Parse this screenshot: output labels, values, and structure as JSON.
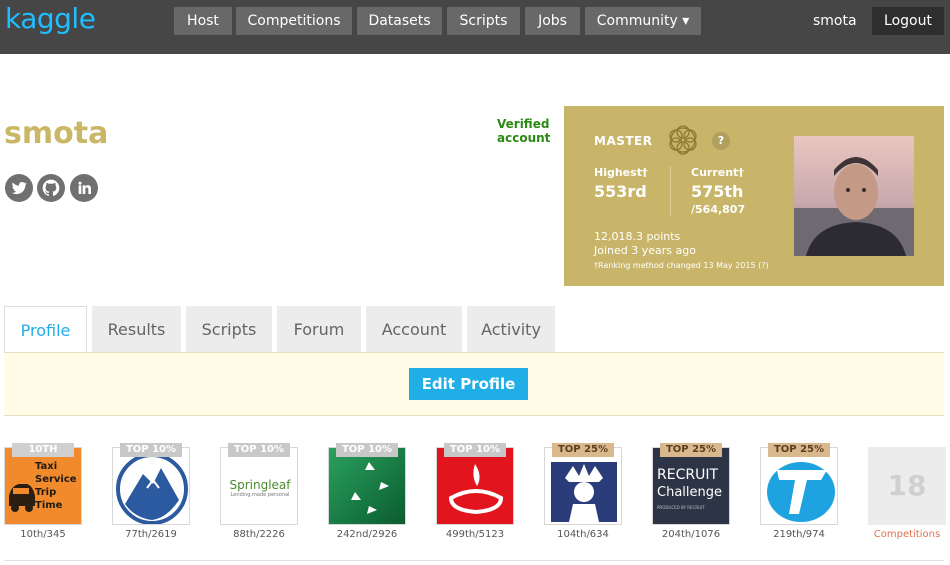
{
  "nav": {
    "logo": "kaggle",
    "items": [
      "Host",
      "Competitions",
      "Datasets",
      "Scripts",
      "Jobs",
      "Community ▾"
    ],
    "user": "smota",
    "logout": "Logout"
  },
  "profile": {
    "username": "smota",
    "verified_line1": "Verified",
    "verified_line2": "account",
    "social_icons": [
      "twitter-icon",
      "github-icon",
      "linkedin-icon"
    ]
  },
  "tier": {
    "label": "MASTER",
    "help": "?",
    "highest_label": "Highest†",
    "highest_value": "553rd",
    "current_label": "Current†",
    "current_value": "575th",
    "current_total": "/564,807",
    "points": "12,018.3 points",
    "joined": "Joined 3 years ago",
    "note": "†Ranking method changed 13 May 2015 (?)",
    "color": "#c9b56a"
  },
  "tabs": [
    "Profile",
    "Results",
    "Scripts",
    "Forum",
    "Account",
    "Activity"
  ],
  "active_tab": "Profile",
  "edit_button": "Edit Profile",
  "competitions": [
    {
      "badge": "10TH",
      "rank": "10th/345",
      "logo_text": [
        "Taxi",
        "Service",
        "Trip Time"
      ]
    },
    {
      "badge": "TOP 10%",
      "rank": "77th/2619"
    },
    {
      "badge": "TOP 10%",
      "rank": "88th/2226",
      "logo_text": [
        "Springleaf",
        "Lending made personal"
      ]
    },
    {
      "badge": "TOP 10%",
      "rank": "242nd/2926"
    },
    {
      "badge": "TOP 10%",
      "rank": "499th/5123"
    },
    {
      "badge": "TOP 25%",
      "rank": "104th/634"
    },
    {
      "badge": "TOP 25%",
      "rank": "204th/1076",
      "logo_text": [
        "RECRUIT",
        "Challenge",
        "PRODUCED BY RECRUIT"
      ]
    },
    {
      "badge": "TOP 25%",
      "rank": "219th/974"
    }
  ],
  "more": {
    "count": "18",
    "label": "Competitions"
  }
}
